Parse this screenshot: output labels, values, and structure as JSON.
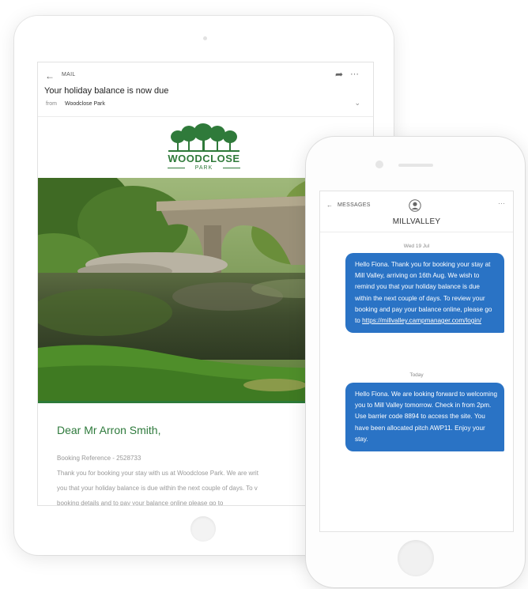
{
  "mail": {
    "app_label": "MAIL",
    "subject": "Your holiday balance is now due",
    "from_label": "from",
    "from_name": "Woodclose Park",
    "logo": {
      "name": "WOODCLOSE",
      "sub": "PARK"
    },
    "greeting": "Dear Mr Arron Smith,",
    "booking_reference": "Booking Reference - 2528733",
    "body_lines": [
      "Thank you for booking your stay with us at Woodclose Park. We are writ",
      "you that your holiday balance is due within the next couple of days. To v",
      "booking details and to pay your balance online please go to"
    ]
  },
  "sms": {
    "app_label": "MESSAGES",
    "contact": "MILLVALLEY",
    "date1": "Wed 19 Jul",
    "message1_text": "Hello Fiona. Thank you for booking your stay at Mill Valley, arriving on 16th Aug. We wish to remind you that your holiday balance is due within the next couple of days. To review your booking and pay your balance online, please go to ",
    "message1_link": "https://millvalley.campmanager.com/login/",
    "date2": "Today",
    "message2_text": "Hello Fiona. We are looking forward to welcoming you to Mill Valley tomorrow. Check in from 2pm. Use barrier code 8894 to access the site. You have been allocated pitch AWP11. Enjoy your stay."
  },
  "colors": {
    "brand_green": "#2e7a3c",
    "bubble_blue": "#2a73c5"
  },
  "icons": [
    "back-arrow-icon",
    "share-icon",
    "more-icon",
    "chevron-down-icon",
    "avatar-icon",
    "tree-logo-icon"
  ]
}
